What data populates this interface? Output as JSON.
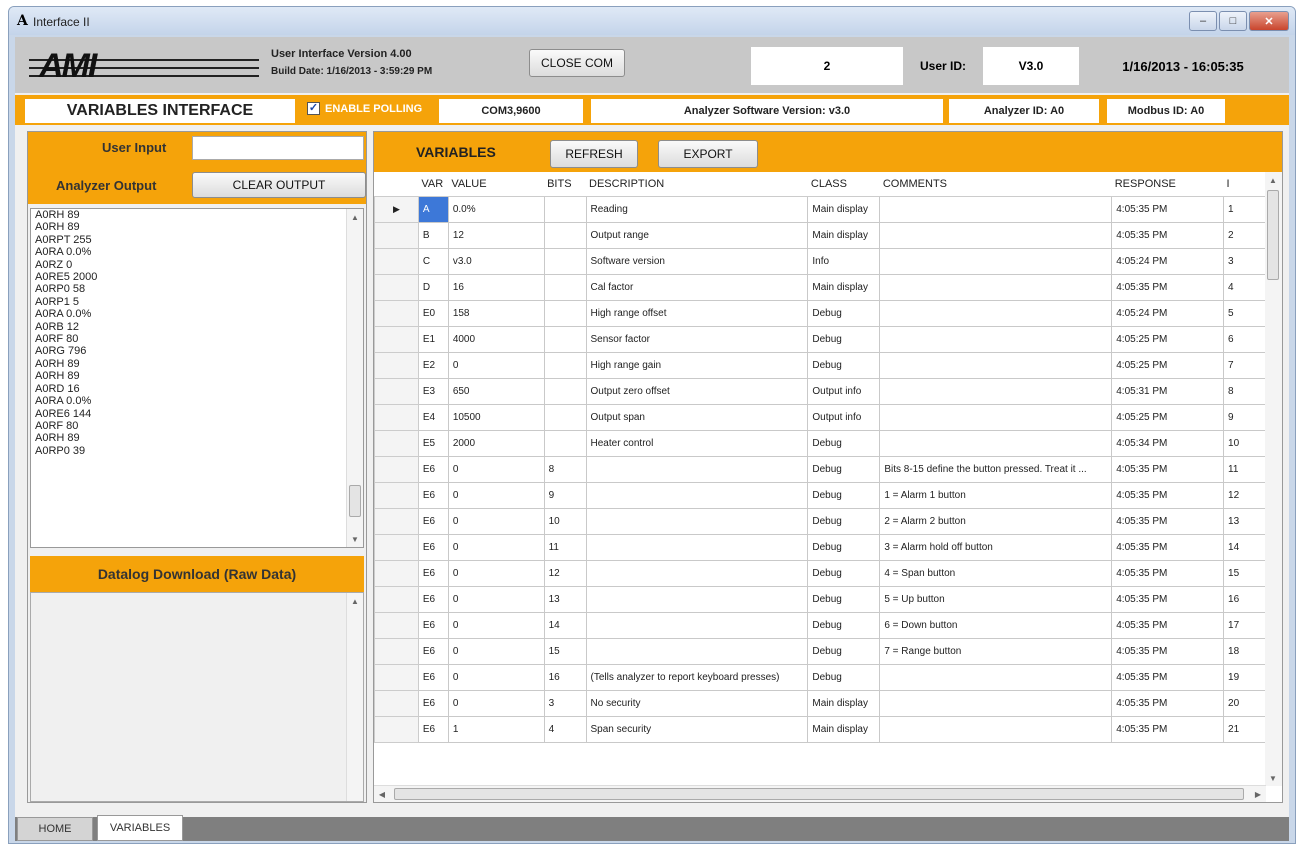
{
  "window": {
    "title": "Interface II",
    "icon_text": "A",
    "btn_min": "‒",
    "btn_max": "□",
    "btn_close": "✕"
  },
  "header": {
    "logo_text": "AMI",
    "version": "User Interface Version 4.00",
    "build_date": "Build Date:  1/16/2013 - 3:59:29 PM",
    "close_com": "CLOSE COM",
    "value_box": "2",
    "user_id_label": "User ID:",
    "user_id": "V3.0",
    "datetime": "1/16/2013 - 16:05:35"
  },
  "status_bar": {
    "title": "VARIABLES INTERFACE",
    "enable_polling": "ENABLE POLLING",
    "polling_checked": "✓",
    "com": "COM3,9600",
    "analyzer_sw": "Analyzer Software Version: v3.0",
    "analyzer_id": "Analyzer ID: A0",
    "modbus_id": "Modbus ID: A0"
  },
  "left": {
    "user_input_label": "User Input",
    "analyzer_output_label": "Analyzer Output",
    "clear_output": "CLEAR OUTPUT",
    "output_lines": [
      "A0RH 89",
      "A0RH 89",
      "A0RPT 255",
      "A0RA 0.0%",
      "A0RZ 0",
      "A0RE5 2000",
      "A0RP0 58",
      "A0RP1 5",
      "A0RA 0.0%",
      "A0RB 12",
      "A0RF 80",
      "A0RG 796",
      "A0RH 89",
      "A0RH 89",
      "A0RD 16",
      "A0RA 0.0%",
      "A0RE6 144",
      "A0RF 80",
      "A0RH 89",
      "A0RP0 39"
    ],
    "datalog_title": "Datalog Download (Raw Data)"
  },
  "variables": {
    "title": "VARIABLES",
    "refresh": "REFRESH",
    "export": "EXPORT",
    "columns": [
      "VAR",
      "VALUE",
      "BITS",
      "DESCRIPTION",
      "CLASS",
      "COMMENTS",
      "RESPONSE",
      "I"
    ],
    "rows": [
      [
        "A",
        "0.0%",
        "",
        "Reading",
        "Main display",
        "",
        "4:05:35 PM",
        "1"
      ],
      [
        "B",
        "12",
        "",
        "Output range",
        "Main display",
        "",
        "4:05:35 PM",
        "2"
      ],
      [
        "C",
        "v3.0",
        "",
        "Software version",
        "Info",
        "",
        "4:05:24 PM",
        "3"
      ],
      [
        "D",
        "16",
        "",
        "Cal factor",
        "Main display",
        "",
        "4:05:35 PM",
        "4"
      ],
      [
        "E0",
        "158",
        "",
        "High range offset",
        "Debug",
        "",
        "4:05:24 PM",
        "5"
      ],
      [
        "E1",
        "4000",
        "",
        "Sensor factor",
        "Debug",
        "",
        "4:05:25 PM",
        "6"
      ],
      [
        "E2",
        "0",
        "",
        "High range gain",
        "Debug",
        "",
        "4:05:25 PM",
        "7"
      ],
      [
        "E3",
        "650",
        "",
        "Output zero offset",
        "Output info",
        "",
        "4:05:31 PM",
        "8"
      ],
      [
        "E4",
        "10500",
        "",
        "Output span",
        "Output info",
        "",
        "4:05:25 PM",
        "9"
      ],
      [
        "E5",
        "2000",
        "",
        "Heater control",
        "Debug",
        "",
        "4:05:34 PM",
        "10"
      ],
      [
        "E6",
        "0",
        "8",
        "",
        "Debug",
        "Bits 8-15 define the button pressed.  Treat it ...",
        "4:05:35 PM",
        "11"
      ],
      [
        "E6",
        "0",
        "9",
        "",
        "Debug",
        "1 = Alarm 1 button",
        "4:05:35 PM",
        "12"
      ],
      [
        "E6",
        "0",
        "10",
        "",
        "Debug",
        "2 = Alarm 2 button",
        "4:05:35 PM",
        "13"
      ],
      [
        "E6",
        "0",
        "11",
        "",
        "Debug",
        "3 = Alarm hold off button",
        "4:05:35 PM",
        "14"
      ],
      [
        "E6",
        "0",
        "12",
        "",
        "Debug",
        "4 = Span button",
        "4:05:35 PM",
        "15"
      ],
      [
        "E6",
        "0",
        "13",
        "",
        "Debug",
        "5 = Up button",
        "4:05:35 PM",
        "16"
      ],
      [
        "E6",
        "0",
        "14",
        "",
        "Debug",
        "6 = Down button",
        "4:05:35 PM",
        "17"
      ],
      [
        "E6",
        "0",
        "15",
        "",
        "Debug",
        "7 = Range button",
        "4:05:35 PM",
        "18"
      ],
      [
        "E6",
        "0",
        "16",
        "(Tells analyzer to report keyboard presses)",
        "Debug",
        "",
        "4:05:35 PM",
        "19"
      ],
      [
        "E6",
        "0",
        "3",
        "No security",
        "Main display",
        "",
        "4:05:35 PM",
        "20"
      ],
      [
        "E6",
        "1",
        "4",
        "Span security",
        "Main display",
        "",
        "4:05:35 PM",
        "21"
      ]
    ]
  },
  "tabs": [
    "HOME",
    "VARIABLES"
  ],
  "colors": {
    "accent": "#f5a30a",
    "selection": "#3d78d8"
  }
}
